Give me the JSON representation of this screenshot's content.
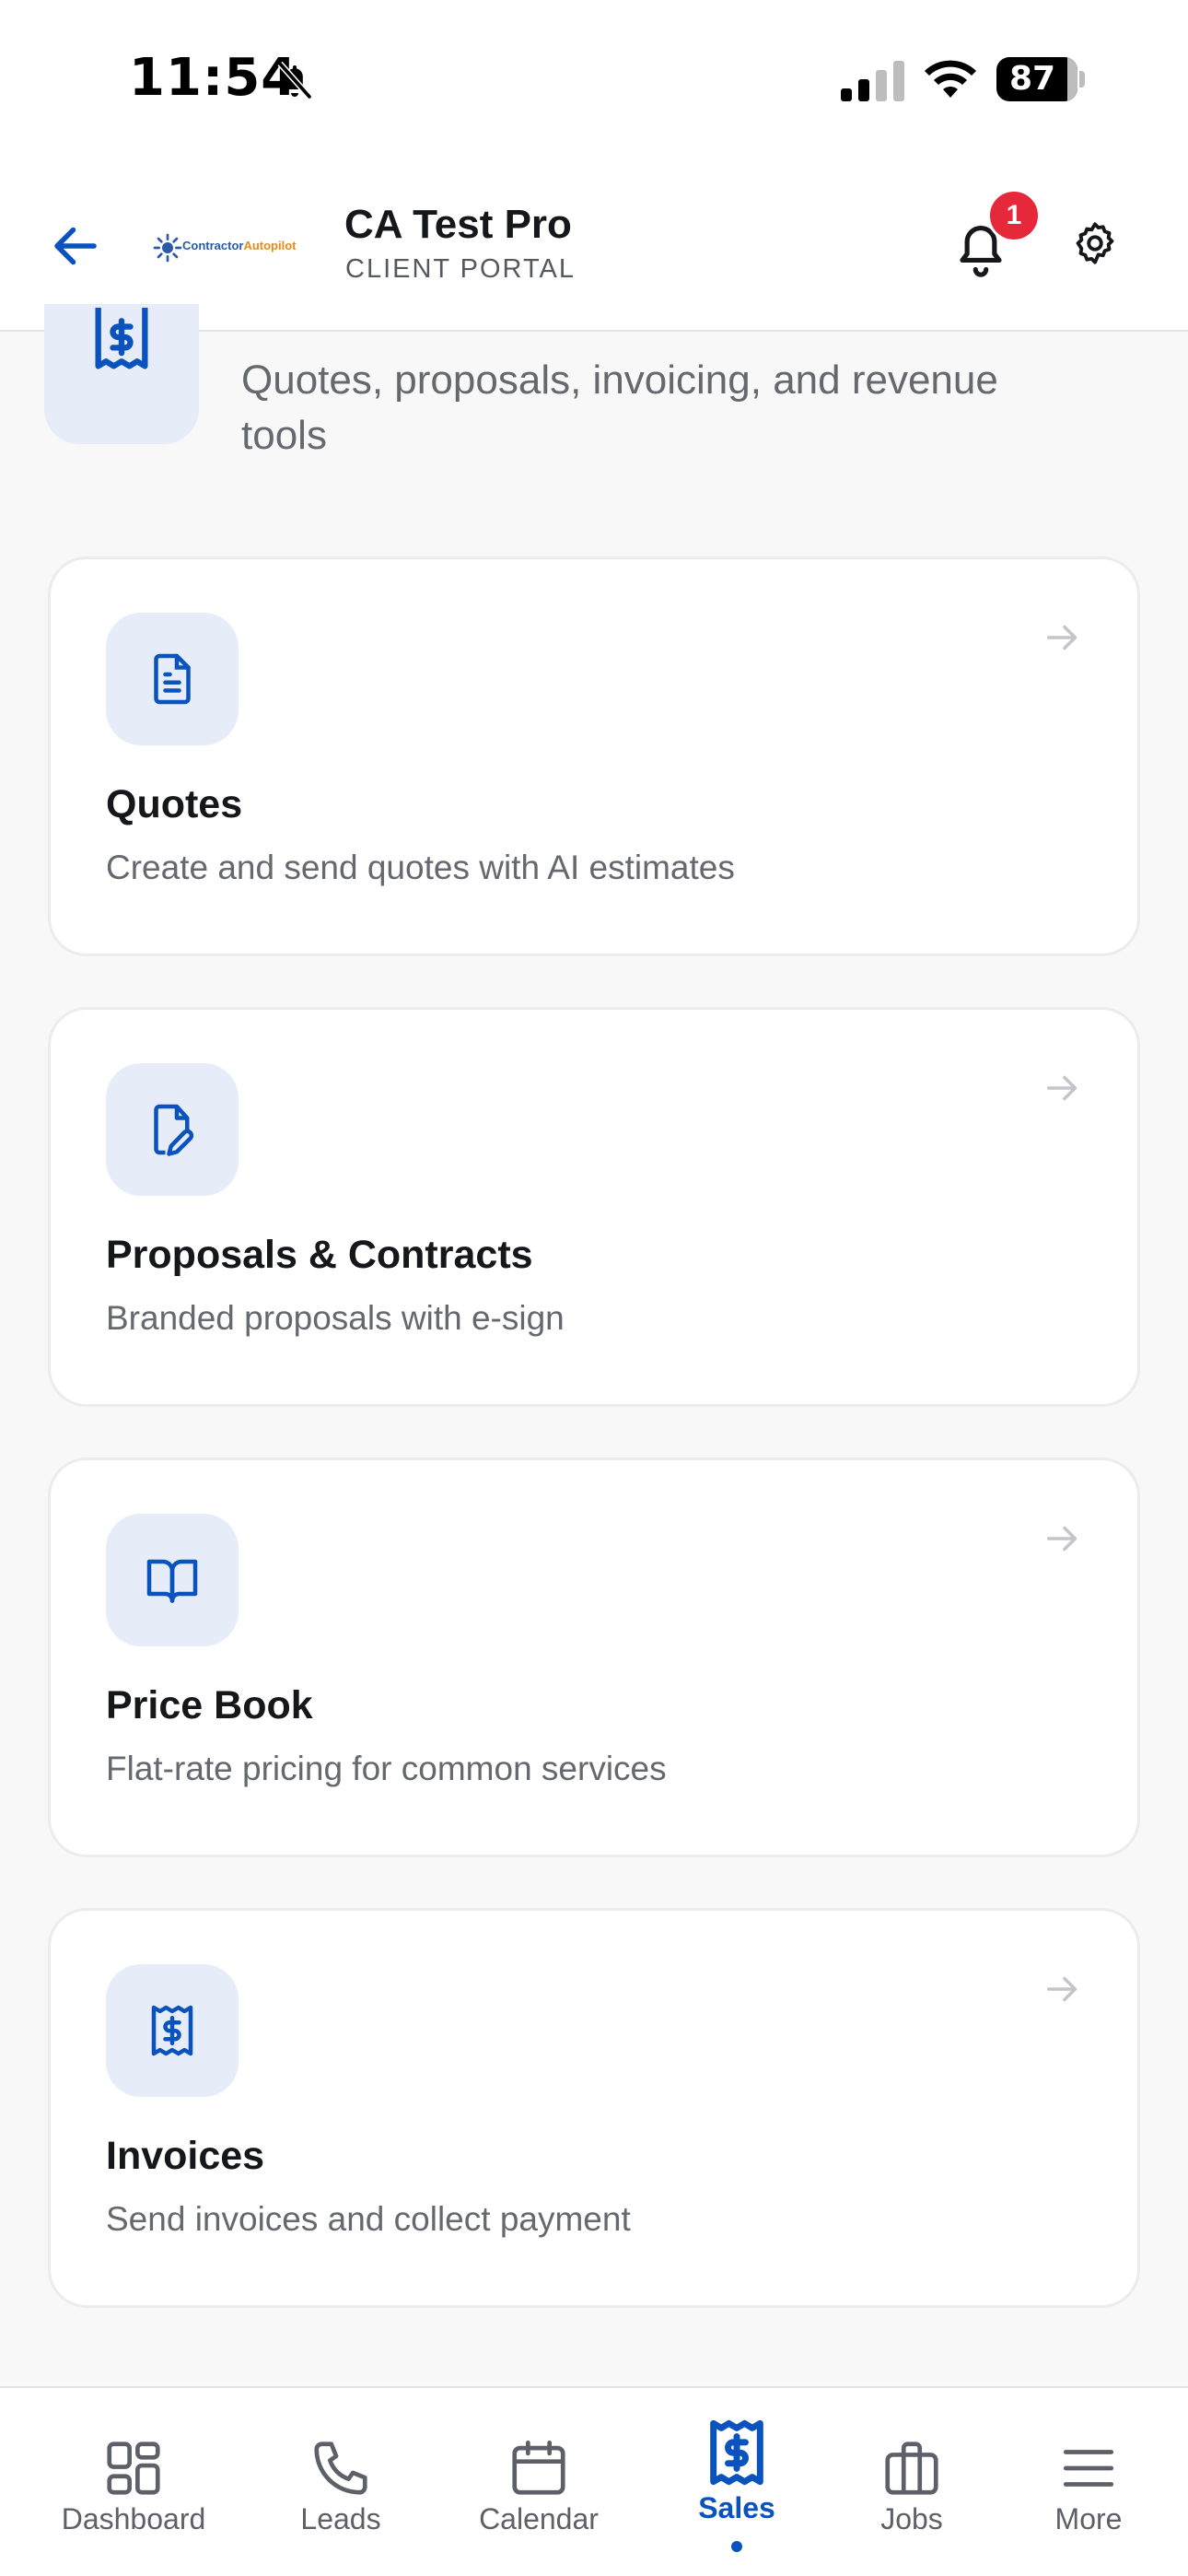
{
  "status_bar": {
    "time": "11:54",
    "battery": "87"
  },
  "header": {
    "org_name": "CA Test Pro",
    "org_subtitle": "CLIENT PORTAL",
    "logo_text_a": "Contractor",
    "logo_text_b": "Autopilot",
    "notification_count": "1"
  },
  "section": {
    "description": "Quotes, proposals, invoicing, and revenue tools"
  },
  "cards": [
    {
      "title": "Quotes",
      "description": "Create and send quotes with AI estimates",
      "icon": "document-icon"
    },
    {
      "title": "Proposals & Contracts",
      "description": "Branded proposals with e-sign",
      "icon": "file-signature-icon"
    },
    {
      "title": "Price Book",
      "description": "Flat-rate pricing for common services",
      "icon": "book-open-icon"
    },
    {
      "title": "Invoices",
      "description": "Send invoices and collect payment",
      "icon": "receipt-icon"
    }
  ],
  "nav": {
    "items": [
      {
        "label": "Dashboard"
      },
      {
        "label": "Leads"
      },
      {
        "label": "Calendar"
      },
      {
        "label": "Sales"
      },
      {
        "label": "Jobs"
      },
      {
        "label": "More"
      }
    ],
    "active": "Sales"
  },
  "colors": {
    "accent": "#0a53be",
    "icon_bg": "#e6edf9",
    "badge": "#e5283a"
  }
}
